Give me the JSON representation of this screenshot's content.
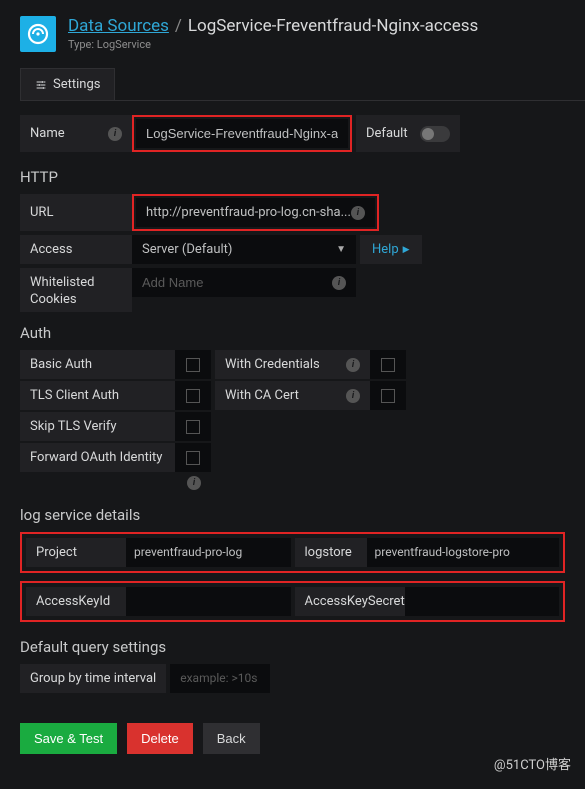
{
  "header": {
    "breadcrumb_link": "Data Sources",
    "separator": "/",
    "title": "LogService-Freventfraud-Nginx-access",
    "subtitle": "Type: LogService"
  },
  "tabs": {
    "settings": "Settings"
  },
  "name_row": {
    "label": "Name",
    "value": "LogService-Freventfraud-Nginx-access",
    "default_label": "Default"
  },
  "http": {
    "section": "HTTP",
    "url_label": "URL",
    "url_value": "http://preventfraud-pro-log.cn-sha...",
    "access_label": "Access",
    "access_value": "Server (Default)",
    "help": "Help",
    "whitelist_label": "Whitelisted Cookies",
    "whitelist_placeholder": "Add Name"
  },
  "auth": {
    "section": "Auth",
    "basic": "Basic Auth",
    "tls_client": "TLS Client Auth",
    "skip_tls": "Skip TLS Verify",
    "forward_oauth": "Forward OAuth Identity",
    "with_credentials": "With Credentials",
    "with_ca": "With CA Cert"
  },
  "logservice": {
    "section": "log service details",
    "project_label": "Project",
    "project_value": "preventfraud-pro-log",
    "logstore_label": "logstore",
    "logstore_value": "preventfraud-logstore-pro",
    "accesskeyid_label": "AccessKeyId",
    "accesskeyid_value": "",
    "accesskeysecret_label": "AccessKeySecret",
    "accesskeysecret_value": ""
  },
  "querysettings": {
    "section": "Default query settings",
    "group_label": "Group by time interval",
    "placeholder": "example: >10s"
  },
  "footer": {
    "save": "Save & Test",
    "delete": "Delete",
    "back": "Back"
  },
  "watermark": "@51CTO博客"
}
